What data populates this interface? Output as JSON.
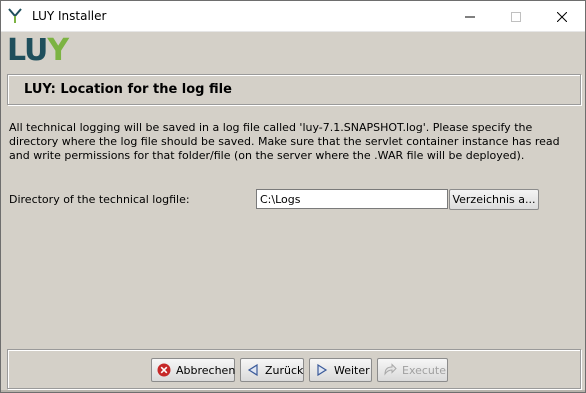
{
  "window": {
    "title": "LUY Installer"
  },
  "logo": {
    "part1": "LU",
    "part2": "Y"
  },
  "header": {
    "title": "LUY: Location for the log file"
  },
  "description": {
    "text": "All technical logging will be saved in a log file called 'luy-7.1.SNAPSHOT.log'. Please specify the directory where the log file should be saved. Make sure that the servlet container instance has read and write permissions for that folder/file (on the server where the .WAR file will be deployed)."
  },
  "directory": {
    "label": "Directory of the technical logfile:",
    "value": "C:\\Logs",
    "browse_label": "Verzeichnis a..."
  },
  "footer": {
    "cancel_label": "Abbrechen",
    "back_label": "Zurück",
    "next_label": "Weiter",
    "execute_label": "Execute"
  },
  "colors": {
    "background": "#d4d0c8",
    "logo_dark": "#1f4f5c",
    "logo_green": "#7cb342",
    "cancel_icon": "#c62828",
    "nav_icon": "#3a5a9a",
    "disabled_text": "#a0a0a0"
  },
  "icons": {
    "app": "luy-y-icon",
    "cancel": "cancel-circle-icon",
    "back": "arrow-left-icon",
    "next": "arrow-right-icon",
    "execute": "execute-arrow-icon"
  }
}
